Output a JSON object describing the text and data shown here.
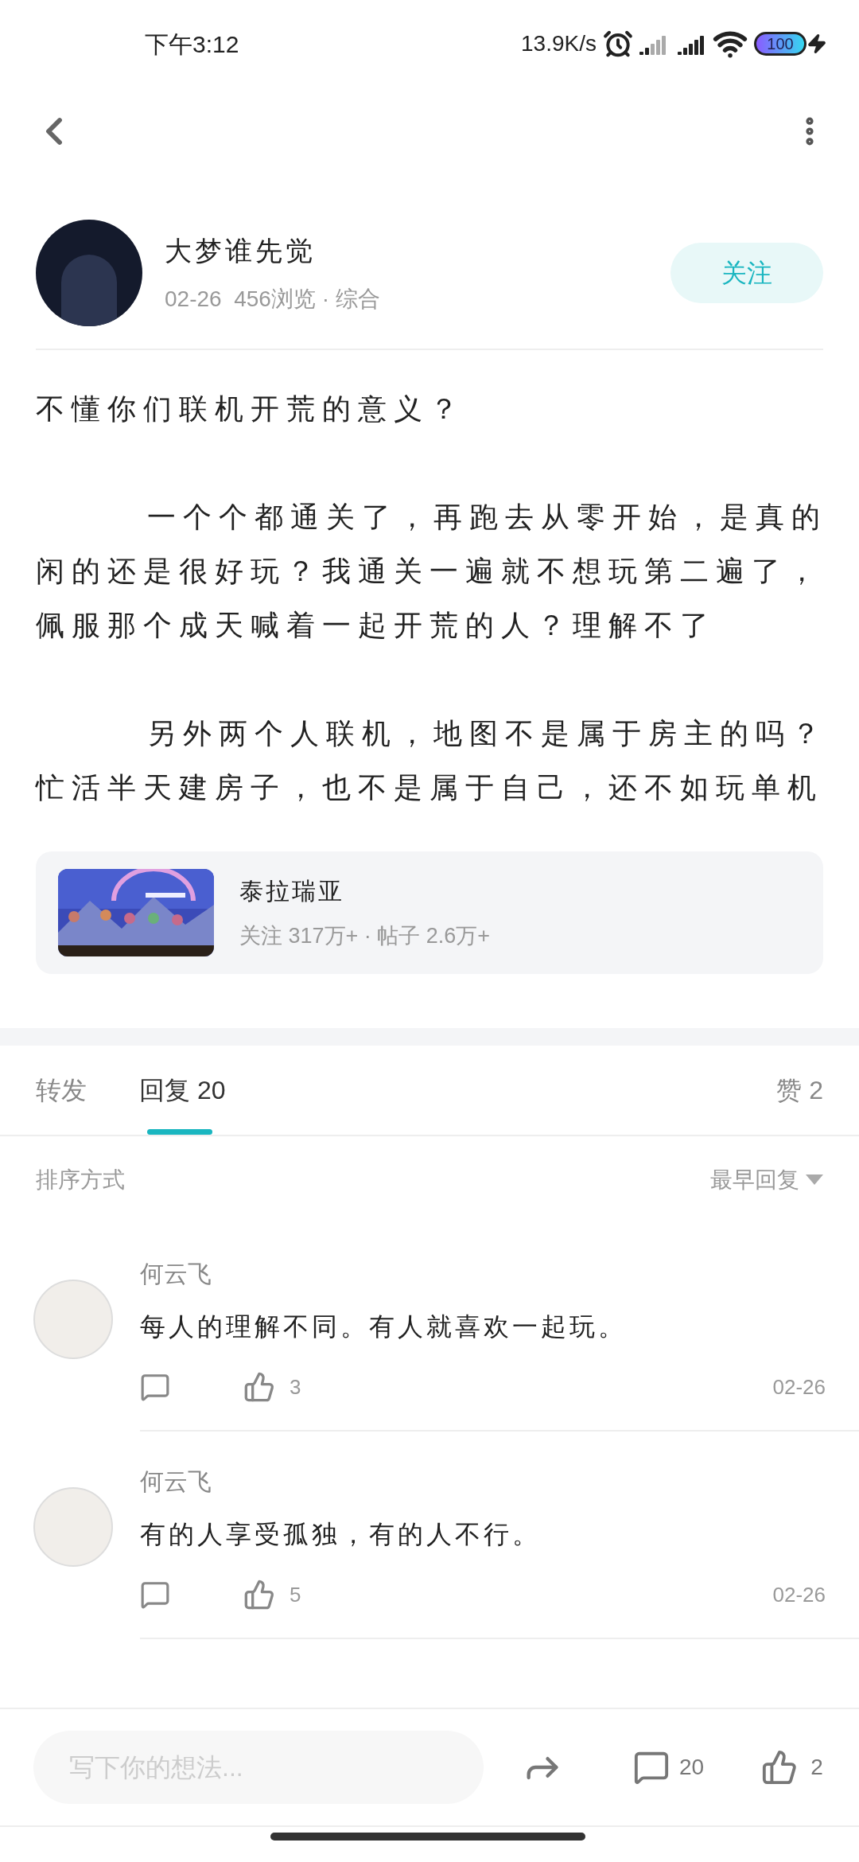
{
  "status_bar": {
    "time": "下午3:12",
    "speed": "13.9K/s",
    "battery": "100"
  },
  "author": {
    "name": "大梦谁先觉",
    "meta": "02-26  456浏览 · 综合",
    "follow": "关注"
  },
  "post": {
    "title": "不懂你们联机开荒的意义？",
    "paragraphs": [
      {
        "text": "一个个都通关了，再跑去从零开始，是真的闲的还是很好玩？我通关一遍就不想玩第二遍了，佩服那个成天喊着一起开荒的人？理解不了",
        "indent": true
      },
      {
        "text": "另外两个人联机，地图不是属于房主的吗？忙活半天建房子，也不是属于自己，还不如玩单机",
        "indent": true
      }
    ]
  },
  "game": {
    "name": "泰拉瑞亚",
    "stats": "关注 317万+ · 帖子 2.6万+"
  },
  "tabs": [
    {
      "label": "转发",
      "selected": false
    },
    {
      "label": "回复 20",
      "selected": true
    },
    {
      "label": "赞 2",
      "selected": false
    }
  ],
  "sort": {
    "label": "排序方式",
    "value": "最早回复"
  },
  "comments": [
    {
      "name": "何云飞",
      "text": "每人的理解不同。有人就喜欢一起玩。",
      "likes": "3",
      "date": "02-26"
    },
    {
      "name": "何云飞",
      "text": "有的人享受孤独，有的人不行。",
      "likes": "5",
      "date": "02-26"
    }
  ],
  "bottom_bar": {
    "placeholder": "写下你的想法...",
    "comments": "20",
    "likes": "2"
  }
}
